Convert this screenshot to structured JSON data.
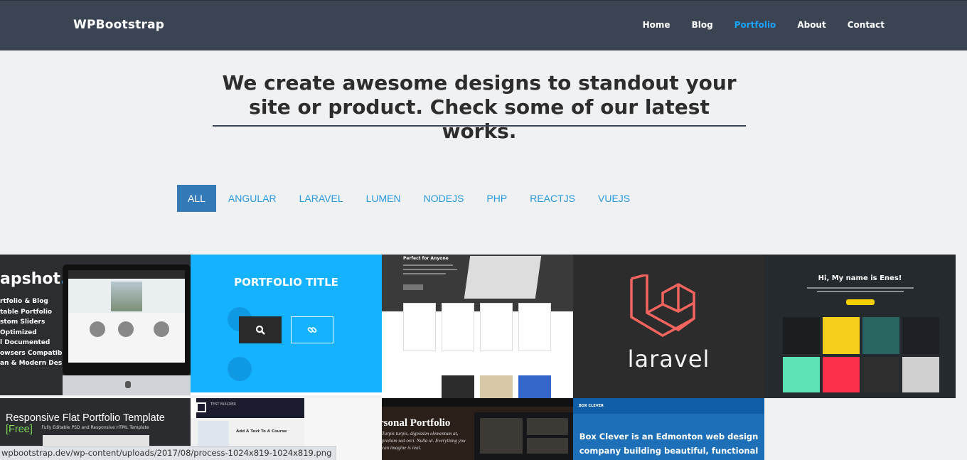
{
  "brand": "WPBootstrap",
  "nav": [
    {
      "label": "Home",
      "active": false
    },
    {
      "label": "Blog",
      "active": false
    },
    {
      "label": "Portfolio",
      "active": true
    },
    {
      "label": "About",
      "active": false
    },
    {
      "label": "Contact",
      "active": false
    }
  ],
  "headline": "We create awesome designs to standout your site or product. Check some of our latest works.",
  "filters": [
    "ALL",
    "ANGULAR",
    "LARAVEL",
    "LUMEN",
    "NODEJS",
    "PHP",
    "REACTJS",
    "VUEJS"
  ],
  "active_filter": "ALL",
  "portfolio": {
    "tile1": {
      "title": "apshot",
      "dot": ".",
      "features": [
        "rtfolio & Blog",
        "table Portfolio",
        "stom Sliders",
        " Optimized",
        "l Documented",
        "owsers Compatibility",
        "an & Modern Design"
      ]
    },
    "tile2": {
      "overlay_title": "PORTFOLIO TITLE",
      "search_icon": "search-icon",
      "link_icon": "link-icon"
    },
    "tile3": {
      "heading": "Perfect for Anyone"
    },
    "tile4": {
      "logo_text": "laravel",
      "logo_color": "#f4645f"
    },
    "tile5": {
      "heading": "Hi, My name is Enes!"
    },
    "tile6": {
      "title": "Responsive Flat Portfolio Template ",
      "free": "[Free]",
      "subtitle": "Fully Editable PSD and Responsive HTML Template"
    },
    "tile7": {
      "brand": "TEST BUILDER",
      "panel_title": "Add A Text To A Course"
    },
    "tile8": {
      "title": "rsonal Portfolio",
      "body": "Turpis turpis, dignissim elementum at, pretium sed orci. Nulla ut. Everything you can imagine is real."
    },
    "tile9": {
      "brand": "BOX CLEVER",
      "text": "Box Clever is an Edmonton web design company building beautiful, functional websites"
    }
  },
  "status_url": "wpbootstrap.dev/wp-content/uploads/2017/08/process-1024x819-1024x819.png",
  "colors": {
    "navbar": "#3b4452",
    "accent": "#1aa3ff",
    "filter_active": "#337ab7",
    "filter_text": "#2c9adf",
    "overlay": "#15b2ff"
  }
}
